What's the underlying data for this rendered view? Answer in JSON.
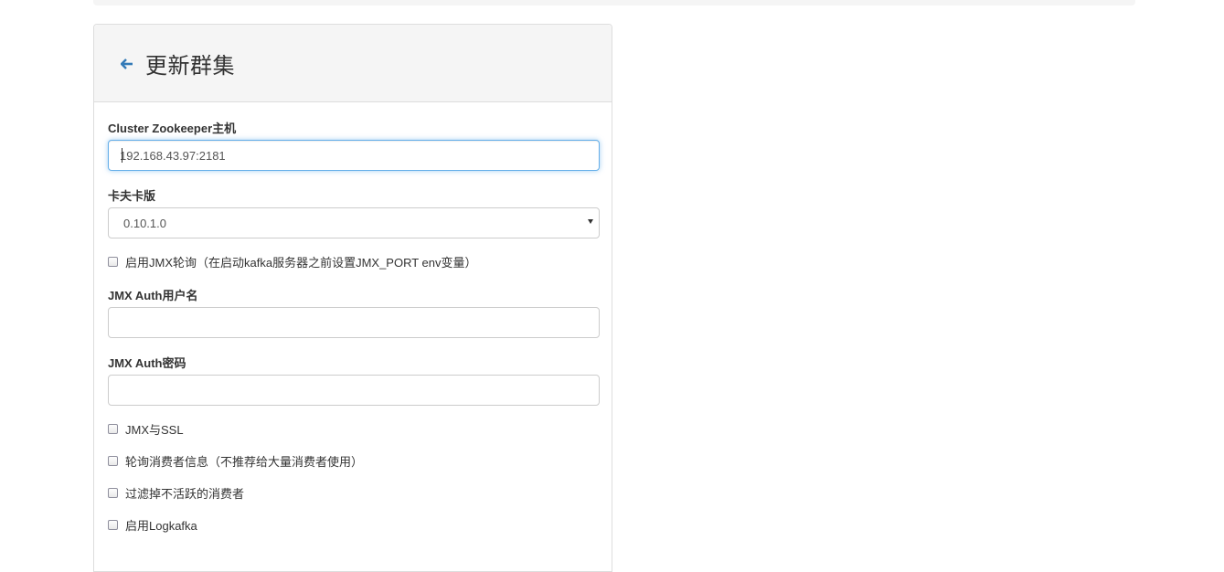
{
  "panel": {
    "title": "更新群集"
  },
  "form": {
    "zookeeper_label": "Cluster Zookeeper主机",
    "zookeeper_value": "192.168.43.97:2181",
    "kafka_version_label": "卡夫卡版",
    "kafka_version_value": "0.10.1.0",
    "jmx_polling_label": "启用JMX轮询（在启动kafka服务器之前设置JMX_PORT env变量）",
    "jmx_user_label": "JMX Auth用户名",
    "jmx_user_value": "",
    "jmx_password_label": "JMX Auth密码",
    "jmx_password_value": "",
    "jmx_ssl_label": "JMX与SSL",
    "poll_consumer_label": "轮询消费者信息（不推荐给大量消费者使用）",
    "filter_inactive_label": "过滤掉不活跃的消费者",
    "logkafka_label": "启用Logkafka"
  },
  "colors": {
    "accent": "#337ab7",
    "focus_border": "#66afe9",
    "heading_bg": "#f5f5f5"
  },
  "icons": {
    "back": "arrow-left-icon"
  }
}
